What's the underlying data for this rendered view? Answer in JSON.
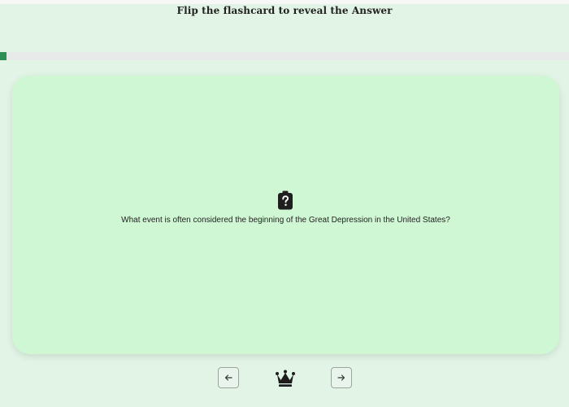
{
  "header": {
    "instruction": "Flip the flashcard to reveal the Answer"
  },
  "progress": {
    "fraction": 0.012,
    "color": "#2d8f55"
  },
  "card": {
    "icon": "clipboard-question-icon",
    "question": "What event is often considered the beginning of the Great Depression in the United States?",
    "background": "#cff7d3"
  },
  "navigation": {
    "previous_icon": "arrow-left-icon",
    "center_icon": "crown-icon",
    "next_icon": "arrow-right-icon"
  }
}
